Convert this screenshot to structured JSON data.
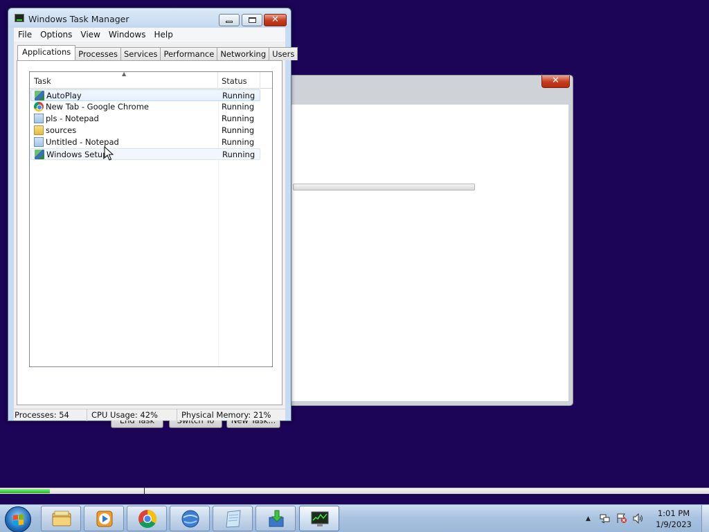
{
  "background_window": {
    "close_label": "✕",
    "progress_percent": 0
  },
  "task_manager": {
    "title": "Windows Task Manager",
    "caption_buttons": {
      "minimize": "",
      "maximize": "",
      "close": "✕"
    },
    "menu": [
      "File",
      "Options",
      "Windows",
      "View",
      "Help"
    ],
    "menu_ordered": [
      "File",
      "Options",
      "View",
      "Windows",
      "Help"
    ],
    "tabs": [
      "Applications",
      "Processes",
      "Services",
      "Performance",
      "Networking",
      "Users"
    ],
    "active_tab": "Applications",
    "columns": {
      "task": "Task",
      "status": "Status"
    },
    "rows": [
      {
        "name": "AutoPlay",
        "status": "Running",
        "icon": "setup-icon"
      },
      {
        "name": "New Tab - Google Chrome",
        "status": "Running",
        "icon": "chrome-icon"
      },
      {
        "name": "pls - Notepad",
        "status": "Running",
        "icon": "notepad-icon"
      },
      {
        "name": "sources",
        "status": "Running",
        "icon": "folder-icon"
      },
      {
        "name": "Untitled - Notepad",
        "status": "Running",
        "icon": "notepad-icon"
      },
      {
        "name": "Windows Setup",
        "status": "Running",
        "icon": "setup-icon"
      }
    ],
    "selected_row": "AutoPlay",
    "buttons": {
      "end_task": "End Task",
      "switch_to": "Switch To",
      "new_task": "New Task..."
    },
    "status": {
      "processes": "Processes: 54",
      "cpu": "CPU Usage: 42%",
      "memory": "Physical Memory: 21%"
    }
  },
  "setup_progress": {
    "fill_fraction": 0.07
  },
  "taskbar": {
    "start_icon": "windows-start-icon",
    "pinned": [
      "explorer-icon",
      "media-player-icon",
      "chrome-icon",
      "ie-icon",
      "notepad-icon",
      "setup-icon",
      "task-manager-icon"
    ],
    "tray_icons": [
      "show-hidden-icon",
      "network-icon",
      "action-center-icon",
      "volume-icon"
    ],
    "clock_time": "1:01 PM",
    "clock_date": "1/9/2023"
  },
  "colors": {
    "desktop": "#1c0456",
    "selection": "#e4effc",
    "close_red": "#c43a1c",
    "progress_green": "#22b522"
  }
}
